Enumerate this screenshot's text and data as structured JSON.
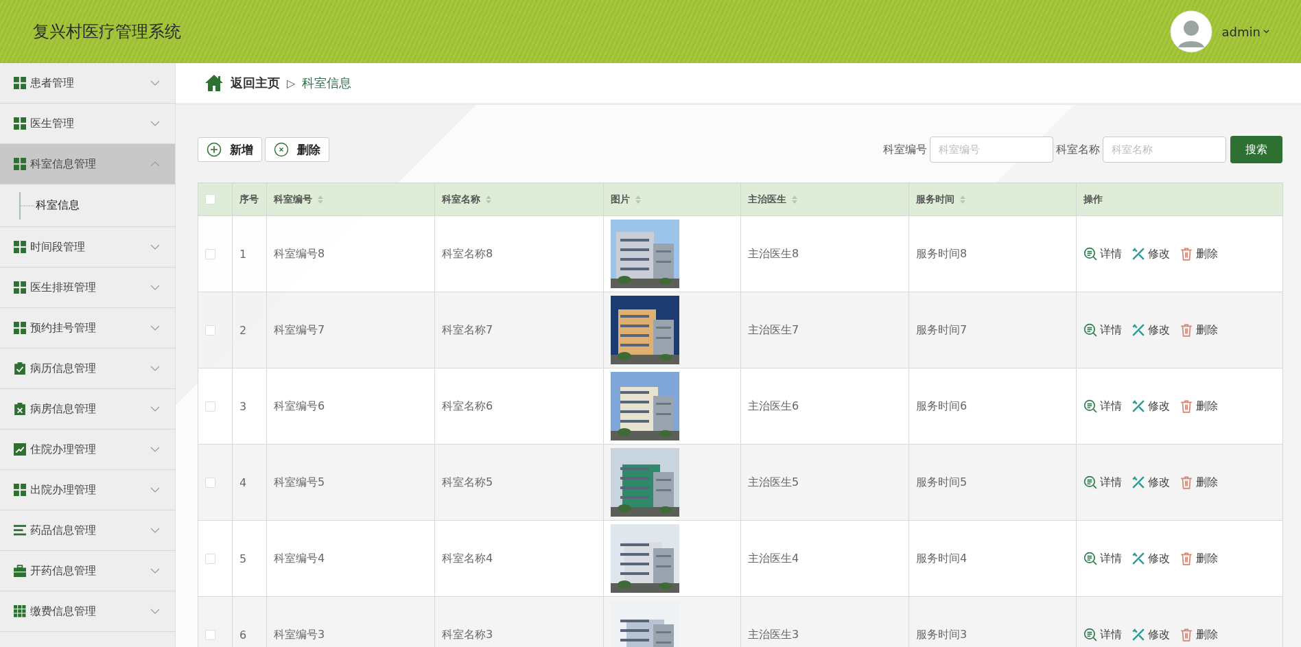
{
  "header": {
    "title": "复兴村医疗管理系统",
    "user": "admin"
  },
  "sidebar": {
    "items": [
      {
        "label": "患者管理",
        "kind": "grid",
        "expanded": false
      },
      {
        "label": "医生管理",
        "kind": "grid",
        "expanded": false
      },
      {
        "label": "科室信息管理",
        "kind": "grid",
        "expanded": true,
        "children": [
          {
            "label": "科室信息"
          }
        ]
      },
      {
        "label": "时间段管理",
        "kind": "grid",
        "expanded": false
      },
      {
        "label": "医生排班管理",
        "kind": "grid",
        "expanded": false
      },
      {
        "label": "预约挂号管理",
        "kind": "grid",
        "expanded": false
      },
      {
        "label": "病历信息管理",
        "kind": "check",
        "expanded": false
      },
      {
        "label": "病房信息管理",
        "kind": "cross",
        "expanded": false
      },
      {
        "label": "住院办理管理",
        "kind": "chart",
        "expanded": false
      },
      {
        "label": "出院办理管理",
        "kind": "grid",
        "expanded": false
      },
      {
        "label": "药品信息管理",
        "kind": "list",
        "expanded": false
      },
      {
        "label": "开药信息管理",
        "kind": "case",
        "expanded": false
      },
      {
        "label": "缴费信息管理",
        "kind": "grid9",
        "expanded": false
      }
    ]
  },
  "breadcrumb": {
    "home": "返回主页",
    "separator": "▷",
    "current": "科室信息"
  },
  "toolbar": {
    "buttons": [
      {
        "label": "新增",
        "kind": "add"
      },
      {
        "label": "删除",
        "kind": "remove"
      }
    ],
    "filters": [
      {
        "label": "科室编号",
        "placeholder": "科室编号"
      },
      {
        "label": "科室名称",
        "placeholder": "科室名称"
      }
    ],
    "search": "搜索"
  },
  "table": {
    "columns": [
      {
        "label": "序号",
        "sortable": false
      },
      {
        "label": "科室编号",
        "sortable": true
      },
      {
        "label": "科室名称",
        "sortable": true
      },
      {
        "label": "图片",
        "sortable": true
      },
      {
        "label": "主治医生",
        "sortable": true
      },
      {
        "label": "服务时间",
        "sortable": true
      },
      {
        "label": "操作",
        "sortable": false
      }
    ],
    "select_all": {
      "checked": false
    },
    "rows": [
      {
        "checked": false,
        "index": "1",
        "code": "科室编号8",
        "name": "科室名称8",
        "doctor": "主治医生8",
        "time": "服务时间8",
        "actions": [
          {
            "label": "详情",
            "kind": "detail"
          },
          {
            "label": "修改",
            "kind": "edit"
          },
          {
            "label": "删除",
            "kind": "delete"
          }
        ]
      },
      {
        "checked": false,
        "index": "2",
        "code": "科室编号7",
        "name": "科室名称7",
        "doctor": "主治医生7",
        "time": "服务时间7",
        "actions": [
          {
            "label": "详情",
            "kind": "detail"
          },
          {
            "label": "修改",
            "kind": "edit"
          },
          {
            "label": "删除",
            "kind": "delete"
          }
        ]
      },
      {
        "checked": false,
        "index": "3",
        "code": "科室编号6",
        "name": "科室名称6",
        "doctor": "主治医生6",
        "time": "服务时间6",
        "actions": [
          {
            "label": "详情",
            "kind": "detail"
          },
          {
            "label": "修改",
            "kind": "edit"
          },
          {
            "label": "删除",
            "kind": "delete"
          }
        ]
      },
      {
        "checked": false,
        "index": "4",
        "code": "科室编号5",
        "name": "科室名称5",
        "doctor": "主治医生5",
        "time": "服务时间5",
        "actions": [
          {
            "label": "详情",
            "kind": "detail"
          },
          {
            "label": "修改",
            "kind": "edit"
          },
          {
            "label": "删除",
            "kind": "delete"
          }
        ]
      },
      {
        "checked": false,
        "index": "5",
        "code": "科室编号4",
        "name": "科室名称4",
        "doctor": "主治医生4",
        "time": "服务时间4",
        "actions": [
          {
            "label": "详情",
            "kind": "detail"
          },
          {
            "label": "修改",
            "kind": "edit"
          },
          {
            "label": "删除",
            "kind": "delete"
          }
        ]
      },
      {
        "checked": false,
        "index": "6",
        "code": "科室编号3",
        "name": "科室名称3",
        "doctor": "主治医生3",
        "time": "服务时间3",
        "actions": [
          {
            "label": "详情",
            "kind": "detail"
          },
          {
            "label": "修改",
            "kind": "edit"
          },
          {
            "label": "删除",
            "kind": "delete"
          }
        ]
      }
    ]
  }
}
